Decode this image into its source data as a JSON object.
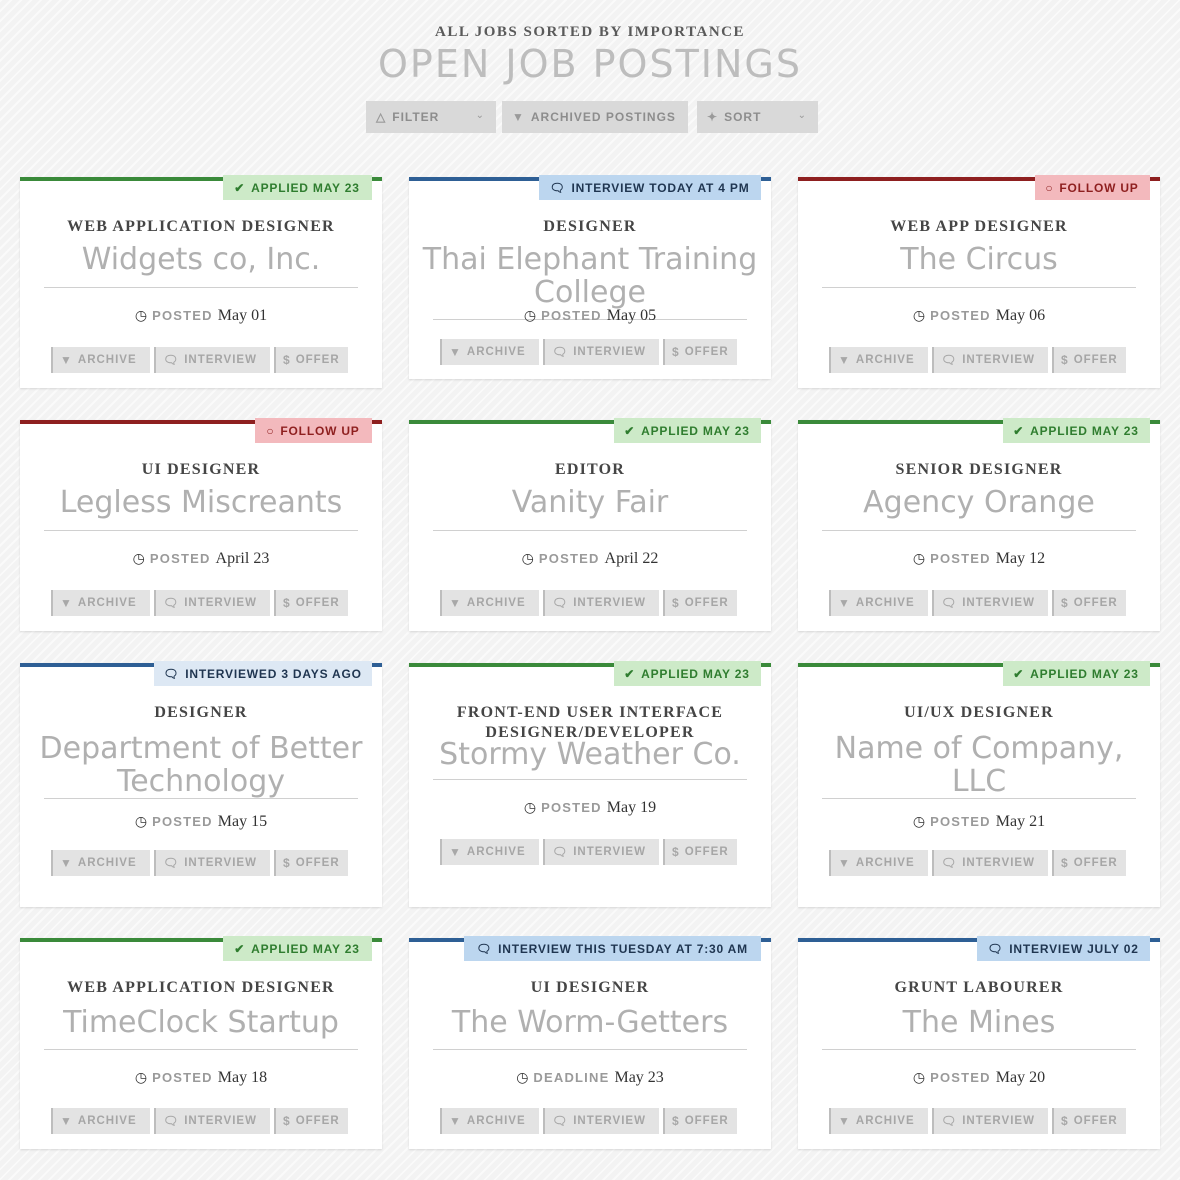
{
  "header": {
    "kicker": "All jobs sorted by importance",
    "title": "Open Job Postings"
  },
  "toolbar": {
    "filter_label": "Filter",
    "archived_label": "Archived Postings",
    "sort_label": "Sort"
  },
  "colors": {
    "green": "#3a8a3a",
    "green_bg": "#cdeac8",
    "green_text": "#2f7d2f",
    "blue": "#2e5f95",
    "blue_bg": "#bcd6ef",
    "blue_text": "#1f3550",
    "red": "#8e1f1f",
    "red_bg": "#f3b9bd",
    "red_text": "#8e1f1f",
    "lightblue": "#2e5f95",
    "lightblue_bg": "#dde8f4"
  },
  "actions": {
    "archive": "Archive",
    "interview": "Interview",
    "offer": "Offer"
  },
  "cards": [
    {
      "status": "green",
      "badge_icon": "check-icon",
      "badge": "Applied May 23",
      "role": "Web Application Designer",
      "company": "Widgets co, Inc.",
      "date_label": "Posted",
      "date": "May 01"
    },
    {
      "status": "blue",
      "badge_icon": "chat-icon",
      "badge": "Interview today at 4 PM",
      "role": "Designer",
      "company": "Thai Elephant Training College",
      "date_label": "Posted",
      "date": ""
    },
    {
      "status": "red",
      "badge_icon": "circle-icon",
      "badge": "Follow up",
      "role": "Web App Designer",
      "company": "The Circus",
      "date_label": "Posted",
      "date": "May 06"
    },
    {
      "status": "red",
      "badge_icon": "circle-icon",
      "badge": "Follow up",
      "role": "UI Designer",
      "company": "Legless Miscreants",
      "date_label": "Posted",
      "date": "April 23"
    },
    {
      "status": "green",
      "badge_icon": "check-icon",
      "badge": "Applied May 23",
      "role": "Editor",
      "company": "Vanity Fair",
      "date_label": "Posted",
      "date": "April 22"
    },
    {
      "status": "green",
      "badge_icon": "check-icon",
      "badge": "Applied May 23",
      "role": "Senior Designer",
      "company": "Agency Orange",
      "date_label": "Posted",
      "date": "May 12"
    },
    {
      "status": "lightblue",
      "badge_icon": "chat-icon",
      "badge": "Interviewed 3 days ago",
      "role": "Designer",
      "company": "Department of Better Technology",
      "date_label": "Posted",
      "date": "May 15"
    },
    {
      "status": "green",
      "badge_icon": "check-icon",
      "badge": "Applied May 23",
      "role": "Front-End User Interface Designer/Developer",
      "company": "Stormy Weather Co.",
      "date_label": "Posted",
      "date": "May 19"
    },
    {
      "status": "green",
      "badge_icon": "check-icon",
      "badge": "Applied May 23",
      "role": "UI/UX Designer",
      "company": "Name of Company, LLC",
      "date_label": "Posted",
      "date": "May 21"
    },
    {
      "status": "green",
      "badge_icon": "check-icon",
      "badge": "Applied May 23",
      "role": "Web Application Designer",
      "company": "TimeClock Startup",
      "date_label": "Posted",
      "date": "May 18"
    },
    {
      "status": "blue",
      "badge_icon": "chat-icon",
      "badge": "Interview this Tuesday at 7:30 AM",
      "role": "UI Designer",
      "company": "The Worm-Getters",
      "date_label": "Deadline",
      "date": "May 23"
    },
    {
      "status": "blue",
      "badge_icon": "chat-icon",
      "badge": "Interview July 02",
      "role": "Grunt Labourer",
      "company": "The Mines",
      "date_label": "Posted",
      "date": "May 20"
    }
  ]
}
